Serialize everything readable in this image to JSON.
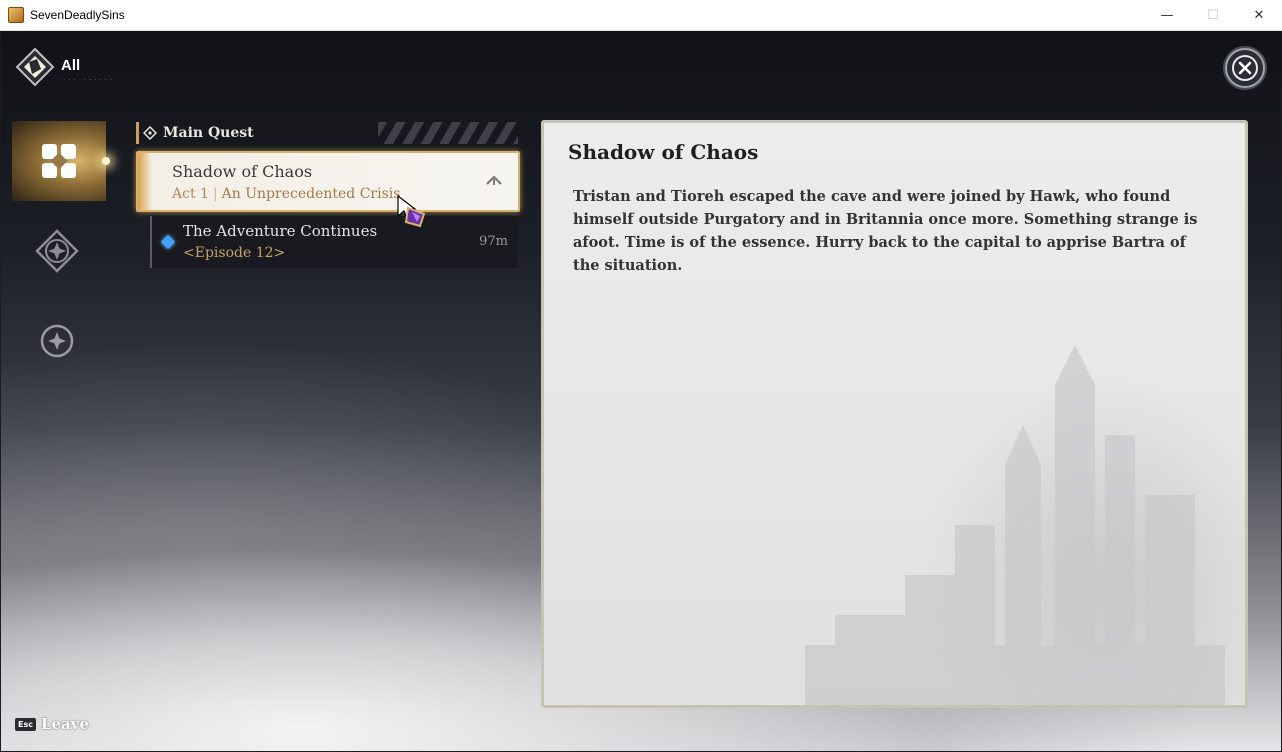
{
  "window": {
    "title": "SevenDeadlySins",
    "minimize": "—",
    "maximize": "☐",
    "close": "✕"
  },
  "filter": {
    "label": "All",
    "sub": "··· ······"
  },
  "rail": {
    "items": [
      {
        "icon": "quest-grid-icon",
        "active": true
      },
      {
        "icon": "compass-star-icon",
        "active": false
      },
      {
        "icon": "circle-star-icon",
        "active": false
      }
    ]
  },
  "quest_list": {
    "section_title": "Main Quest",
    "selected": {
      "title": "Shadow of Chaos",
      "act": "Act 1",
      "chapter": "An Unprecedented Crisis"
    },
    "sub_quest": {
      "title": "The Adventure Continues",
      "episode": "<Episode 12>",
      "distance": "97m"
    }
  },
  "detail": {
    "title": "Shadow of Chaos",
    "body": "Tristan and Tioreh escaped the cave and were joined by Hawk, who found himself outside Purgatory and in Britannia once more. Something strange is afoot. Time is of the essence. Hurry back to the capital to apprise Bartra of the situation."
  },
  "footer": {
    "esc_key": "Esc",
    "leave_label": "Leave"
  },
  "colors": {
    "accent_gold": "#d9b06a",
    "marker_blue": "#3fa3ff"
  }
}
